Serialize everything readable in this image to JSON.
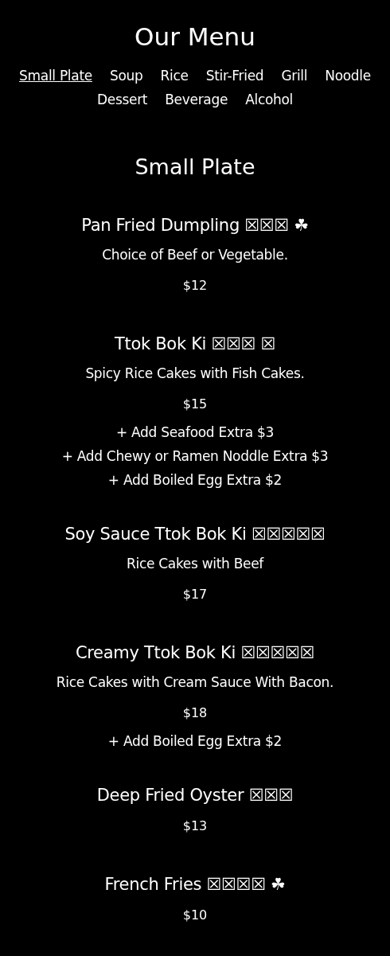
{
  "title": "Our Menu",
  "tabs": [
    {
      "label": "Small Plate",
      "selected": true
    },
    {
      "label": "Soup",
      "selected": false
    },
    {
      "label": "Rice",
      "selected": false
    },
    {
      "label": "Stir-Fried",
      "selected": false
    },
    {
      "label": "Grill",
      "selected": false
    },
    {
      "label": "Noodle",
      "selected": false
    },
    {
      "label": "Dessert",
      "selected": false
    },
    {
      "label": "Beverage",
      "selected": false
    },
    {
      "label": "Alcohol",
      "selected": false
    }
  ],
  "section": {
    "heading": "Small Plate",
    "items": [
      {
        "name": "Pan Fried Dumpling ☒☒☒ ☘",
        "description": "Choice of Beef or Vegetable.",
        "price": "$12"
      },
      {
        "name": "Ttok Bok Ki ☒☒☒ ☒",
        "description": "Spicy Rice Cakes with Fish Cakes.",
        "price": "$15",
        "extras": [
          "+ Add Seafood Extra $3",
          "+ Add Chewy or Ramen Noddle Extra $3",
          "+ Add Boiled Egg Extra $2"
        ]
      },
      {
        "name": "Soy Sauce Ttok Bok Ki ☒☒☒☒☒",
        "description": "Rice Cakes with Beef",
        "price": "$17"
      },
      {
        "name": "Creamy Ttok Bok Ki ☒☒☒☒☒",
        "description": "Rice Cakes with Cream Sauce With Bacon.",
        "price": "$18",
        "extras": [
          "+ Add Boiled Egg Extra $2"
        ]
      },
      {
        "name": "Deep Fried Oyster ☒☒☒",
        "price": "$13"
      },
      {
        "name": "French Fries ☒☒☒☒ ☘",
        "price": "$10"
      }
    ]
  }
}
